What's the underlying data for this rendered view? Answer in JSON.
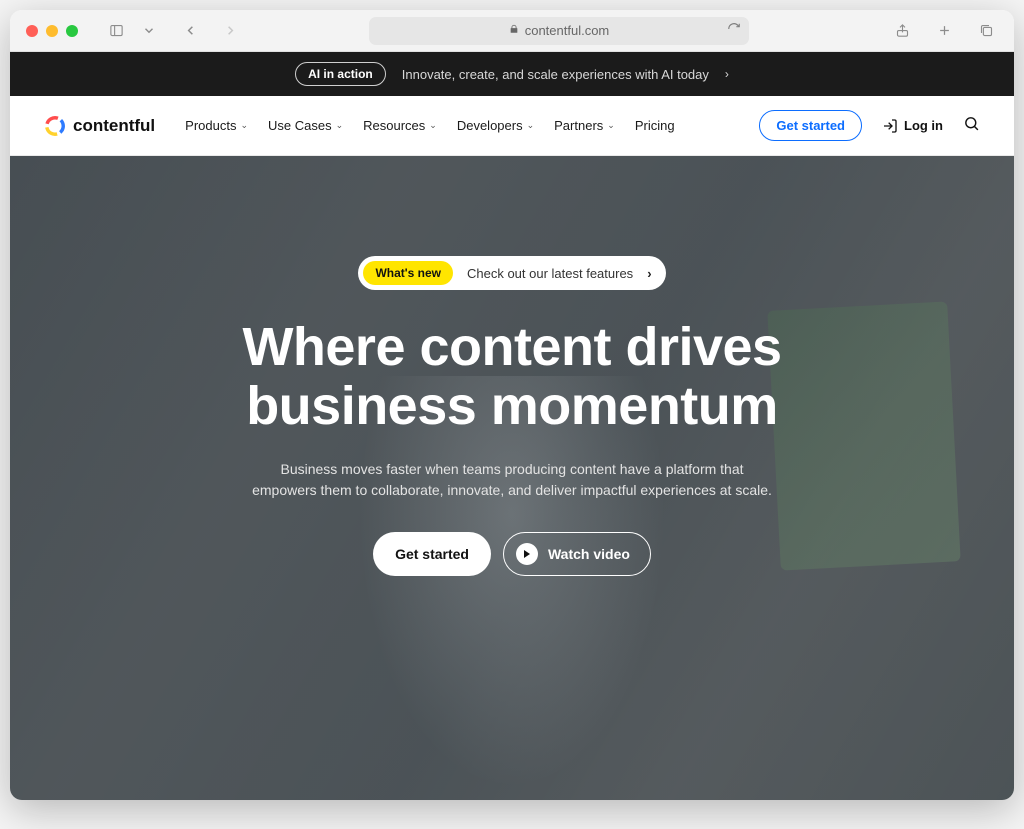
{
  "browser": {
    "url_host": "contentful.com"
  },
  "announcement": {
    "pill_label": "AI in action",
    "text": "Innovate, create, and scale experiences with AI today"
  },
  "brand": {
    "name": "contentful"
  },
  "nav": {
    "items": [
      {
        "label": "Products",
        "has_dropdown": true
      },
      {
        "label": "Use Cases",
        "has_dropdown": true
      },
      {
        "label": "Resources",
        "has_dropdown": true
      },
      {
        "label": "Developers",
        "has_dropdown": true
      },
      {
        "label": "Partners",
        "has_dropdown": true
      },
      {
        "label": "Pricing",
        "has_dropdown": false
      }
    ],
    "get_started_label": "Get started",
    "login_label": "Log in"
  },
  "hero": {
    "whats_new_tag": "What's new",
    "whats_new_text": "Check out our latest features",
    "headline_line1": "Where content drives",
    "headline_line2": "business momentum",
    "subhead": "Business moves faster when teams producing content have a platform that empowers them to collaborate, innovate, and deliver impactful experiences at scale.",
    "cta_primary": "Get started",
    "cta_secondary": "Watch video"
  }
}
